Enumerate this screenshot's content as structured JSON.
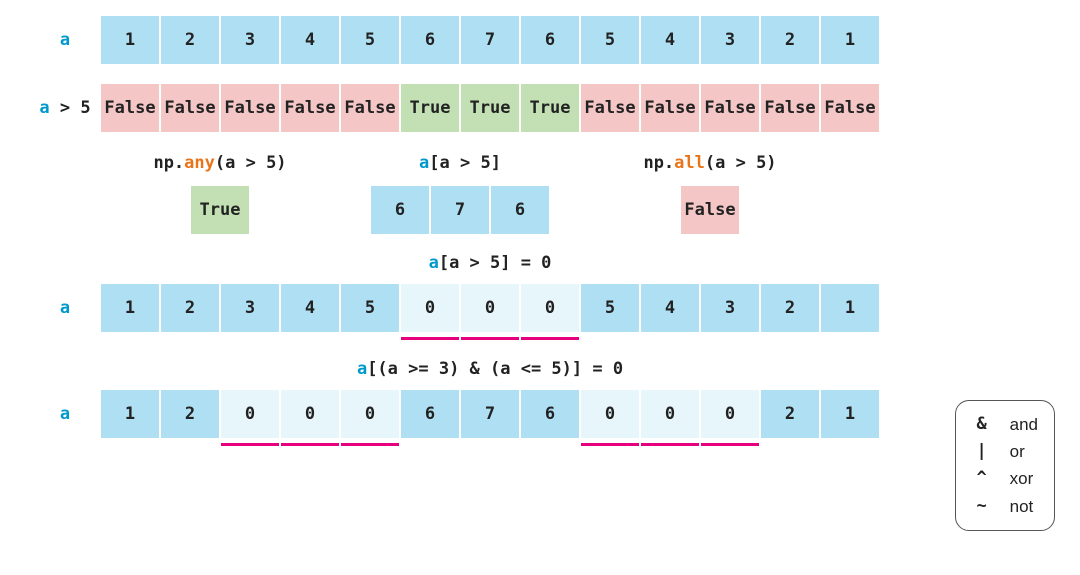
{
  "colors": {
    "blue": "#aedff2",
    "lightblue": "#e6f6fb",
    "green": "#c3e0b4",
    "red": "#f5c6c6",
    "magenta": "#e6007e",
    "accent_a": "#0099cc",
    "accent_fn": "#e8751a"
  },
  "row_a": {
    "label_a": "a",
    "values": [
      "1",
      "2",
      "3",
      "4",
      "5",
      "6",
      "7",
      "6",
      "5",
      "4",
      "3",
      "2",
      "1"
    ]
  },
  "row_cmp": {
    "label_a": "a",
    "label_op": " > 5",
    "values": [
      "False",
      "False",
      "False",
      "False",
      "False",
      "True",
      "True",
      "True",
      "False",
      "False",
      "False",
      "False",
      "False"
    ]
  },
  "any": {
    "code_pre": "np.",
    "code_fn": "any",
    "code_post": "(a > 5)",
    "result": "True"
  },
  "sel": {
    "code_a": "a",
    "code_rest": "[a > 5]",
    "values": [
      "6",
      "7",
      "6"
    ]
  },
  "all": {
    "code_pre": "np.",
    "code_fn": "all",
    "code_post": "(a > 5)",
    "result": "False"
  },
  "assign1": {
    "code_a": "a",
    "code_rest": "[a > 5] = 0"
  },
  "row_a2": {
    "label_a": "a",
    "values": [
      "1",
      "2",
      "3",
      "4",
      "5",
      "0",
      "0",
      "0",
      "5",
      "4",
      "3",
      "2",
      "1"
    ],
    "zero_idx": [
      5,
      6,
      7
    ],
    "underline_ranges": [
      [
        5,
        7
      ]
    ]
  },
  "assign2": {
    "code_a": "a",
    "code_rest": "[(a >= 3) & (a <= 5)] = 0"
  },
  "row_a3": {
    "label_a": "a",
    "values": [
      "1",
      "2",
      "0",
      "0",
      "0",
      "6",
      "7",
      "6",
      "0",
      "0",
      "0",
      "2",
      "1"
    ],
    "zero_idx": [
      2,
      3,
      4,
      8,
      9,
      10
    ],
    "underline_ranges": [
      [
        2,
        4
      ],
      [
        8,
        10
      ]
    ]
  },
  "legend": [
    {
      "sym": "&",
      "word": "and"
    },
    {
      "sym": "|",
      "word": "or"
    },
    {
      "sym": "^",
      "word": "xor"
    },
    {
      "sym": "~",
      "word": "not"
    }
  ]
}
